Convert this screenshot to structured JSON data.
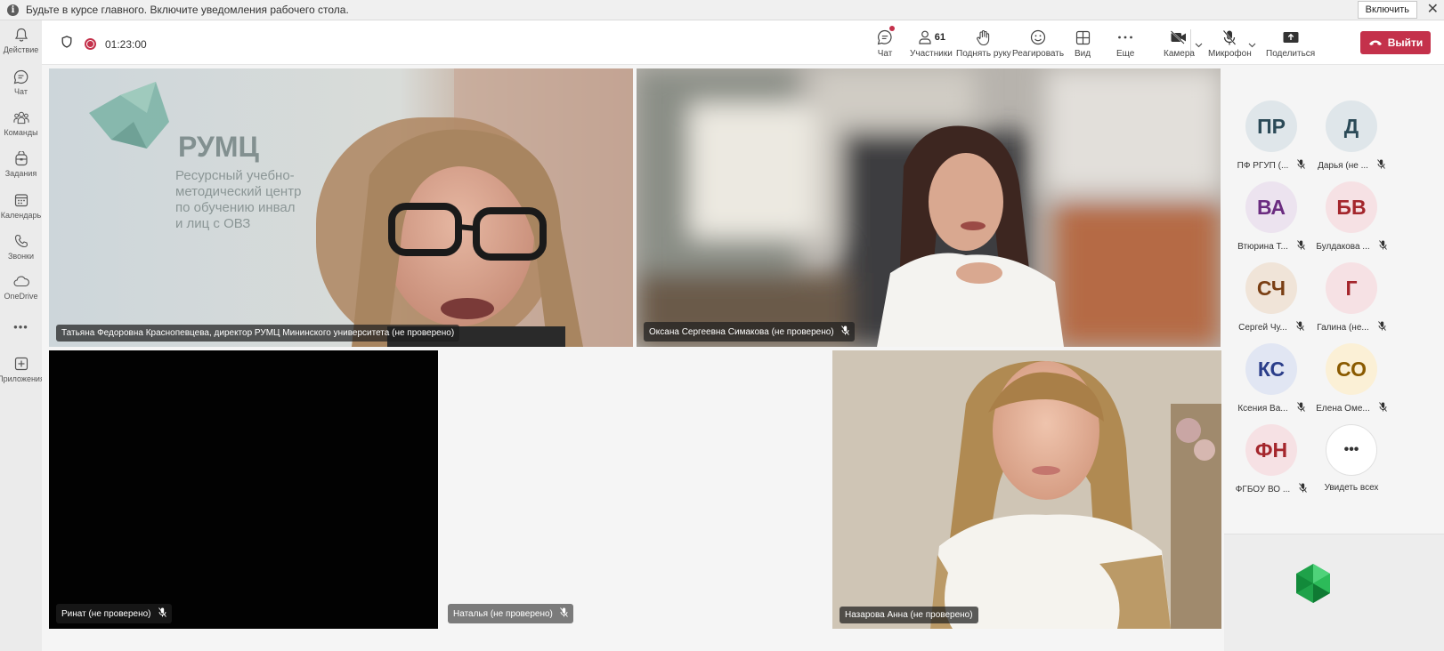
{
  "notification": {
    "message": "Будьте в курсе главного. Включите уведомления рабочего стола.",
    "enable_label": "Включить",
    "close_label": "✕"
  },
  "rail": [
    {
      "label": "Действие",
      "icon": "bell-icon"
    },
    {
      "label": "Чат",
      "icon": "chat-icon"
    },
    {
      "label": "Команды",
      "icon": "teams-icon"
    },
    {
      "label": "Задания",
      "icon": "assignments-icon"
    },
    {
      "label": "Календарь",
      "icon": "calendar-icon"
    },
    {
      "label": "Звонки",
      "icon": "phone-icon"
    },
    {
      "label": "OneDrive",
      "icon": "cloud-icon"
    },
    {
      "label": "•••",
      "icon": "more-icon"
    },
    {
      "label": "Приложения",
      "icon": "apps-icon"
    }
  ],
  "meeting": {
    "timer": "01:23:00",
    "tools": {
      "chat": "Чат",
      "participants": "Участники",
      "participants_count": "61",
      "raise_hand": "Поднять руку",
      "react": "Реагировать",
      "view": "Вид",
      "more": "Еще",
      "camera": "Камера",
      "mic": "Микрофон",
      "share": "Поделиться",
      "leave": "Выйти"
    }
  },
  "tiles": [
    {
      "name": "Татьяна Федоровна Краснопевцева, директор РУМЦ Мининского университета (не проверено)"
    },
    {
      "name": "Оксана Сергеевна Симакова (не проверено)"
    },
    {
      "name": "Ринат (не проверено)"
    },
    {
      "name": "Наталья (не проверено)"
    },
    {
      "name": "Назарова Анна (не проверено)"
    }
  ],
  "banner": {
    "brand": "РУМЦ",
    "line1": "Ресурсный учебно-",
    "line2": "методический центр",
    "line3": "по обучению инвал",
    "line4": "и лиц с ОВЗ"
  },
  "roster": [
    {
      "initials": "ПР",
      "name": "ПФ РГУП (...",
      "bg": "#dfe6ea",
      "fg": "#2b4a57"
    },
    {
      "initials": "Д",
      "name": "Дарья (не ...",
      "bg": "#dfe6ea",
      "fg": "#2b4a57"
    },
    {
      "initials": "ВА",
      "name": "Втюрина Т...",
      "bg": "#ece3ef",
      "fg": "#6b2c80"
    },
    {
      "initials": "БВ",
      "name": "Булдакова ...",
      "bg": "#f6e1e4",
      "fg": "#a4262c"
    },
    {
      "initials": "СЧ",
      "name": "Сергей Чу...",
      "bg": "#f0e4d8",
      "fg": "#7a3f14"
    },
    {
      "initials": "Г",
      "name": "Галина (не...",
      "bg": "#f6e1e4",
      "fg": "#a4262c"
    },
    {
      "initials": "КС",
      "name": "Ксения Ва...",
      "bg": "#e1e6f3",
      "fg": "#2b3e8a"
    },
    {
      "initials": "СО",
      "name": "Елена Оме...",
      "bg": "#fbf0d6",
      "fg": "#8a5a00"
    },
    {
      "initials": "ФН",
      "name": "ФГБОУ ВО ...",
      "bg": "#f6e1e4",
      "fg": "#a4262c"
    },
    {
      "initials": "•••",
      "name": "Увидеть всех",
      "bg": "#ffffff",
      "fg": "#333333"
    }
  ],
  "colors": {
    "accent": "#5b5fc7",
    "leave": "#c4314b"
  }
}
